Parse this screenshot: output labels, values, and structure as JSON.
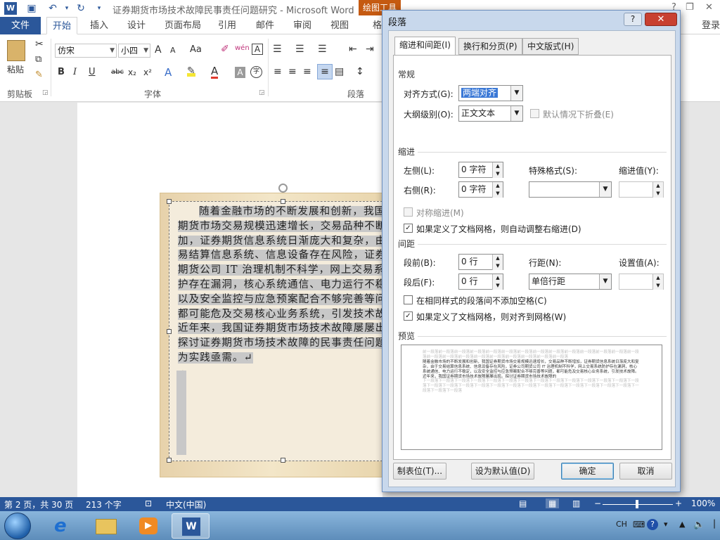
{
  "title_bar": {
    "document_title": "证券期货市场技术故障民事责任问题研究 - Microsoft Word",
    "context_tab": "绘图工具",
    "help": "?",
    "win_minimize": "—",
    "win_restore": "❐",
    "win_close": "✕"
  },
  "ribbon_tabs": {
    "file": "文件",
    "tabs": [
      "开始",
      "插入",
      "设计",
      "页面布局",
      "引用",
      "邮件",
      "审阅",
      "视图",
      "格"
    ],
    "login": "登录"
  },
  "ribbon": {
    "paste": "粘贴",
    "clipboard_label": "剪贴板",
    "font_label": "字体",
    "paragraph_label": "段落",
    "font_name": "仿宋",
    "font_size": "小四",
    "grow_font": "A",
    "shrink_font": "A",
    "change_case": "Aa",
    "phonetic": "wén",
    "char_border": "A",
    "bold": "B",
    "italic": "I",
    "underline": "U",
    "strike": "abc",
    "subscript": "x₂",
    "superscript": "x²",
    "text_effects": "A",
    "font_color": "A",
    "char_shading": "A",
    "enclose": "字"
  },
  "document": {
    "paragraph": "随着金融市场的不断发展和创新，我国证券期货市场交易规模迅速增长，交易品种不断增加，证券期货信息系统日渐庞大和复杂，由于交易结算信息系统、信息设备存在风险，证券公司期货公司 IT 治理机制不科学，网上交易系统防护存在漏洞，核心系统通信、电力运行不稳定，以及安全监控与应急预案配合不够完善等问题，都可能危及交易核心业务系统，引发技术故障。近年来，我国证券期货市场技术故障屡屡出现。探讨证券期货市场技术故障的民事责任问题已经为实践亟需。",
    "end_mark": "↵",
    "empty_mark": "↵"
  },
  "dialog": {
    "title": "段落",
    "help": "?",
    "close": "✕",
    "tabs": [
      "缩进和间距(I)",
      "换行和分页(P)",
      "中文版式(H)"
    ],
    "general": {
      "section": "常规",
      "alignment_label": "对齐方式(G):",
      "alignment_value": "两端对齐",
      "outline_label": "大纲级别(O):",
      "outline_value": "正文文本",
      "collapse_label": "默认情况下折叠(E)",
      "collapse_checked": false
    },
    "indent": {
      "section": "缩进",
      "left_label": "左侧(L):",
      "left_value": "0 字符",
      "right_label": "右侧(R):",
      "right_value": "0 字符",
      "special_label": "特殊格式(S):",
      "special_value": "",
      "by_label": "缩进值(Y):",
      "by_value": "",
      "mirror_label": "对称缩进(M)",
      "mirror_checked": false,
      "auto_adjust_label": "如果定义了文档网格，则自动调整右缩进(D)",
      "auto_adjust_checked": true
    },
    "spacing": {
      "section": "间距",
      "before_label": "段前(B):",
      "before_value": "0 行",
      "after_label": "段后(F):",
      "after_value": "0 行",
      "line_label": "行距(N):",
      "line_value": "单倍行距",
      "at_label": "设置值(A):",
      "at_value": "",
      "no_space_label": "在相同样式的段落间不添加空格(C)",
      "no_space_checked": false,
      "snap_grid_label": "如果定义了文档网格，则对齐到网格(W)",
      "snap_grid_checked": true
    },
    "preview": {
      "section": "预览",
      "prev_text": "前一段落前一段落前一段落前一段落前一段落前一段落前一段落前一段落前一段落前一段落前一段落前一段落前一段落前一段落前一段落前一段落前一段落前一段落前一段落前一段落前一段落前一段落前一段落",
      "sample_text": "随着金融市场的不断发展和创新，我国证券期货市场交易规模迅速增长，交易品种不断增加，证券期货信息系统日渐庞大和复杂，由于交易结算信息系统、信息设备存在风险，证券公司期货公司 IT 治理机制不科学，网上交易系统防护存在漏洞，核心系统通信、电力运行不稳定，以及安全监控与应急预案配合不够完善等问题，都可能危及交易核心业务系统，引发技术故障。近年来，我国证券期货市场技术故障屡屡出现。探讨证券期货市场技术故障的",
      "next_text": "下一段落下一段落下一段落下一段落下一段落下一段落下一段落下一段落下一段落下一段落下一段落下一段落下一段落下一段落下一段落下一段落下一段落下一段落下一段落下一段落下一段落下一段落下一段落下一段落下一段落下一段落下一段落下一段落下一段落下一段落"
    },
    "buttons": {
      "tabs": "制表位(T)...",
      "set_default": "设为默认值(D)",
      "ok": "确定",
      "cancel": "取消"
    }
  },
  "status_bar": {
    "page": "第 2 页，共 30 页",
    "words": "213 个字",
    "language": "中文(中国)",
    "zoom": "100%",
    "zoom_out": "−",
    "zoom_in": "+"
  },
  "taskbar": {
    "ime": "CH",
    "help": "?"
  },
  "colors": {
    "word_blue": "#2b579a",
    "context_orange": "#c55a11",
    "close_red": "#c84031",
    "selection_grey": "#c8c8c8"
  }
}
